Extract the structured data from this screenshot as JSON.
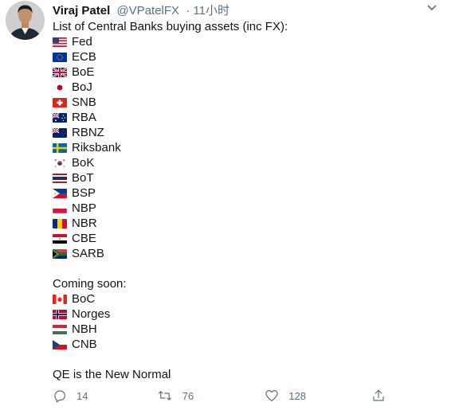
{
  "author": {
    "name": "Viraj Patel",
    "handle": "@VPatelFX",
    "time": "· 11小时"
  },
  "tweet": {
    "intro": "List of Central Banks buying assets (inc FX):",
    "banks": [
      {
        "label": "Fed",
        "flag_icon": "flag-us-icon"
      },
      {
        "label": "ECB",
        "flag_icon": "flag-eu-icon"
      },
      {
        "label": "BoE",
        "flag_icon": "flag-uk-icon"
      },
      {
        "label": "BoJ",
        "flag_icon": "flag-jp-icon"
      },
      {
        "label": "SNB",
        "flag_icon": "flag-ch-icon"
      },
      {
        "label": "RBA",
        "flag_icon": "flag-au-icon"
      },
      {
        "label": "RBNZ",
        "flag_icon": "flag-nz-icon"
      },
      {
        "label": "Riksbank",
        "flag_icon": "flag-se-icon"
      },
      {
        "label": "BoK",
        "flag_icon": "flag-kr-icon"
      },
      {
        "label": "BoT",
        "flag_icon": "flag-th-icon"
      },
      {
        "label": "BSP",
        "flag_icon": "flag-ph-icon"
      },
      {
        "label": "NBP",
        "flag_icon": "flag-pl-icon"
      },
      {
        "label": "NBR",
        "flag_icon": "flag-ro-icon"
      },
      {
        "label": "CBE",
        "flag_icon": "flag-eg-icon"
      },
      {
        "label": "SARB",
        "flag_icon": "flag-za-icon"
      }
    ],
    "coming_soon_label": "Coming soon:",
    "coming_soon": [
      {
        "label": "BoC",
        "flag_icon": "flag-ca-icon"
      },
      {
        "label": "Norges",
        "flag_icon": "flag-no-icon"
      },
      {
        "label": "NBH",
        "flag_icon": "flag-hu-icon"
      },
      {
        "label": "CNB",
        "flag_icon": "flag-cz-icon"
      }
    ],
    "closing": "QE is the New Normal"
  },
  "actions": {
    "replies": "14",
    "retweets": "76",
    "likes": "128"
  },
  "colors": {
    "text": "#0f1419",
    "secondary": "#5b7083",
    "background": "#ffffff"
  }
}
